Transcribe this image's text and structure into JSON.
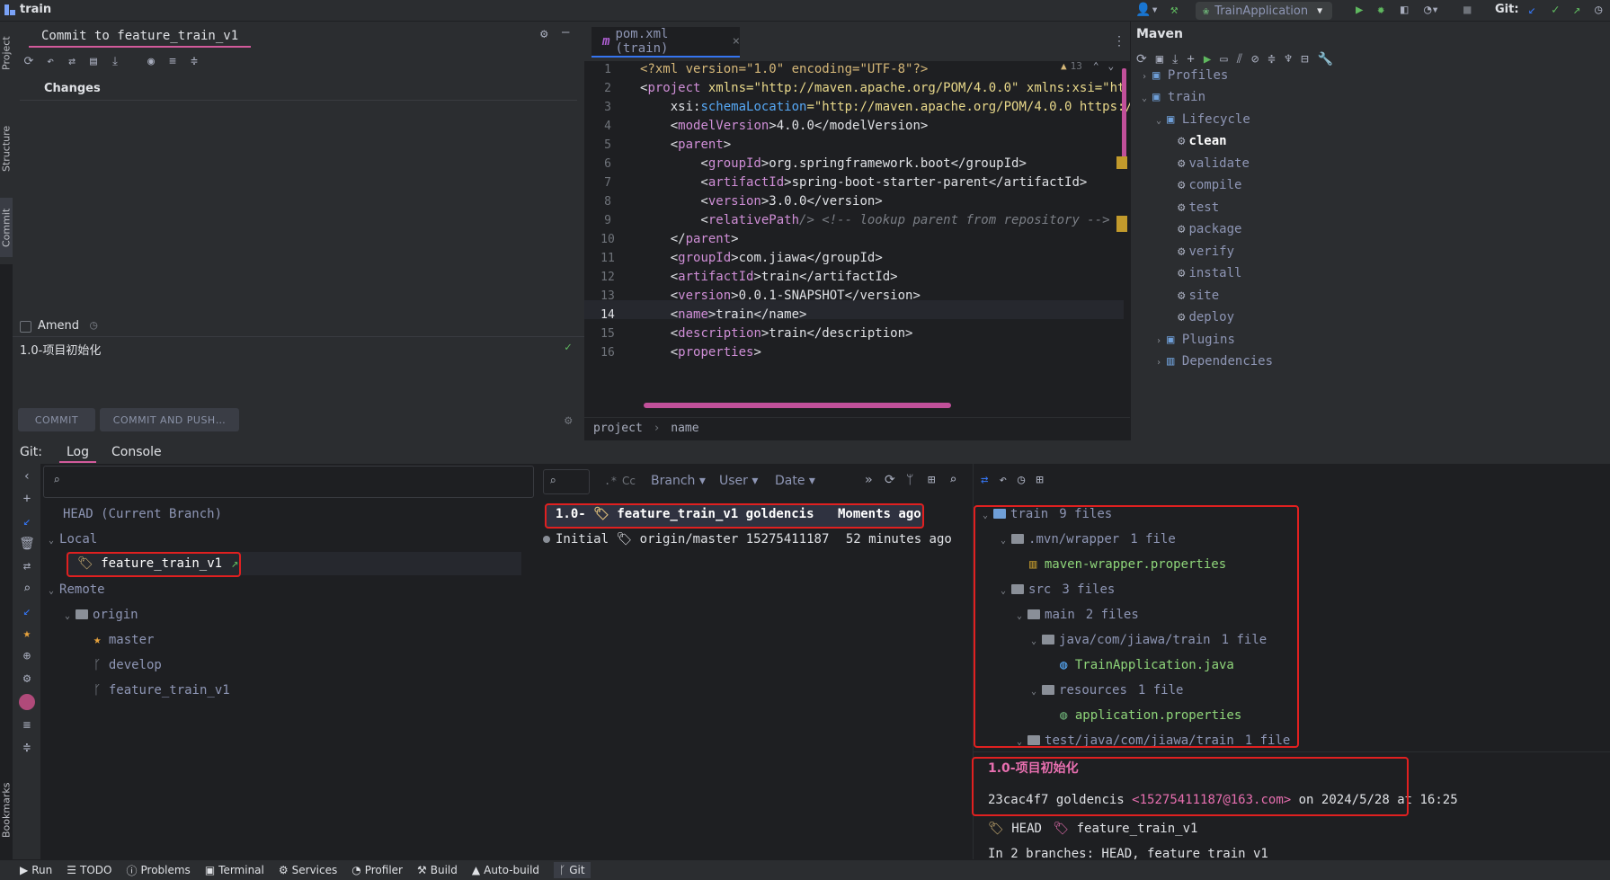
{
  "window": {
    "title": "train"
  },
  "top_bar": {
    "run_config": "TrainApplication",
    "git_label": "Git:"
  },
  "left_stripe": {
    "tabs": [
      "Project",
      "Structure",
      "Commit"
    ],
    "bottom_tab": "Bookmarks"
  },
  "commit_panel": {
    "tab_title": "Commit to feature_train_v1",
    "changes_label": "Changes",
    "amend_label": "Amend",
    "message": "1.0-项目初始化",
    "commit_button": "COMMIT",
    "commit_push_button": "COMMIT AND PUSH…"
  },
  "editor": {
    "tab_label": "pom.xml (train)",
    "warning_count": "13",
    "line_numbers": [
      "1",
      "2",
      "3",
      "4",
      "5",
      "6",
      "7",
      "8",
      "9",
      "10",
      "11",
      "12",
      "13",
      "14",
      "15",
      "16"
    ],
    "lines": [
      {
        "pre": "<?",
        "tag": "xml",
        "rest": " version=\"1.0\" encoding=\"UTF-8\"?>"
      },
      {
        "pre": "<",
        "tag": "project",
        "rest": " xmlns=\"http://maven.apache.org/POM/4.0.0\" xmlns:xsi=\"ht"
      },
      {
        "pre": "    xsi:",
        "tag": "schemaLocation",
        "rest": "=\"http://maven.apache.org/POM/4.0.0 https:/"
      },
      {
        "pre": "    <",
        "tag": "modelVersion",
        "rest": ">4.0.0</modelVersion>"
      },
      {
        "pre": "    <",
        "tag": "parent",
        "rest": ">"
      },
      {
        "pre": "        <",
        "tag": "groupId",
        "rest": ">org.springframework.boot</groupId>"
      },
      {
        "pre": "        <",
        "tag": "artifactId",
        "rest": ">spring-boot-starter-parent</artifactId>"
      },
      {
        "pre": "        <",
        "tag": "version",
        "rest": ">3.0.0</version>"
      },
      {
        "pre": "        <",
        "tag": "relativePath",
        "rest": "/> <!-- lookup parent from repository -->"
      },
      {
        "pre": "    </",
        "tag": "parent",
        "rest": ">"
      },
      {
        "pre": "    <",
        "tag": "groupId",
        "rest": ">com.jiawa</groupId>"
      },
      {
        "pre": "    <",
        "tag": "artifactId",
        "rest": ">train</artifactId>"
      },
      {
        "pre": "    <",
        "tag": "version",
        "rest": ">0.0.1-SNAPSHOT</version>"
      },
      {
        "pre": "    <",
        "tag": "name",
        "rest": ">train</name>"
      },
      {
        "pre": "    <",
        "tag": "description",
        "rest": ">train</description>"
      },
      {
        "pre": "    <",
        "tag": "properties",
        "rest": ">"
      }
    ],
    "breadcrumb": [
      "project",
      "name"
    ]
  },
  "maven": {
    "title": "Maven",
    "profiles": "Profiles",
    "project": "train",
    "lifecycle": "Lifecycle",
    "phases": [
      "clean",
      "validate",
      "compile",
      "test",
      "package",
      "verify",
      "install",
      "site",
      "deploy"
    ],
    "plugins": "Plugins",
    "dependencies": "Dependencies"
  },
  "git": {
    "label": "Git:",
    "tabs": [
      "Log",
      "Console"
    ],
    "search_placeholder": "",
    "branches": {
      "head": "HEAD (Current Branch)",
      "local": "Local",
      "local_branches": [
        "feature_train_v1"
      ],
      "remote": "Remote",
      "remote_origin": "origin",
      "remote_branches": [
        "master",
        "develop",
        "feature_train_v1"
      ]
    },
    "log_filters": [
      "Branch",
      "User",
      "Date"
    ],
    "log_filter_prefix": "Cc",
    "commits": [
      {
        "message": "1.0-",
        "refs": "feature_train_v1",
        "author": "goldencis",
        "date": "Moments ago"
      },
      {
        "message": "Initial",
        "refs": "origin/master",
        "author": "15275411187",
        "date": "52 minutes ago"
      }
    ],
    "changed_files": {
      "root": "train",
      "root_count": "9 files",
      "wrapper": ".mvn/wrapper",
      "wrapper_count": "1 file",
      "wrapper_file": "maven-wrapper.properties",
      "src": "src",
      "src_count": "3 files",
      "main": "main",
      "main_count": "2 files",
      "java_dir": "java/com/jiawa/train",
      "java_count": "1 file",
      "java_file": "TrainApplication.java",
      "res_dir": "resources",
      "res_count": "1 file",
      "res_file": "application.properties",
      "test_dir": "test/java/com/jiawa/train",
      "test_count": "1 file"
    },
    "commit_details": {
      "title": "1.0-项目初始化",
      "hash": "23cac4f7",
      "author": "goldencis",
      "email": "<15275411187@163.com>",
      "on": "on",
      "date": "2024/5/28 at 16:25",
      "ref_head": "HEAD",
      "ref_branch": "feature_train_v1",
      "branches_info": "In 2 branches: HEAD, feature_train_v1"
    }
  },
  "status_bar": [
    "Run",
    "TODO",
    "Problems",
    "Terminal",
    "Services",
    "Profiler",
    "Build",
    "Auto-build",
    "Git"
  ],
  "colors": {
    "accent": "#3574f0",
    "commit_tab_underline": "#d25a9b",
    "annotation_red": "#e02020",
    "tag_pink": "#cf8ed6"
  }
}
